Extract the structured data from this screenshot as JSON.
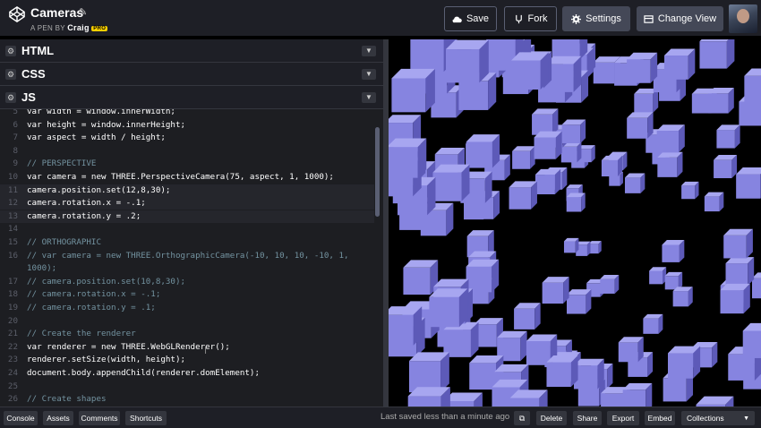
{
  "header": {
    "title": "Cameras",
    "subtitle_prefix": "A PEN BY",
    "author": "Craig",
    "badge": "PRO",
    "buttons": {
      "save": "Save",
      "fork": "Fork",
      "settings": "Settings",
      "change_view": "Change View"
    }
  },
  "panels": {
    "html": "HTML",
    "css": "CSS",
    "js": "JS"
  },
  "code_lines": [
    {
      "n": "5",
      "t": "var width = window.innerWidth;",
      "comment": false,
      "hl": false
    },
    {
      "n": "6",
      "t": "var height = window.innerHeight;",
      "comment": false,
      "hl": false
    },
    {
      "n": "7",
      "t": "var aspect = width / height;",
      "comment": false,
      "hl": false
    },
    {
      "n": "8",
      "t": "",
      "comment": false,
      "hl": false
    },
    {
      "n": "9",
      "t": "// PERSPECTIVE",
      "comment": true,
      "hl": false
    },
    {
      "n": "10",
      "t": "var camera = new THREE.PerspectiveCamera(75, aspect, 1, 1000);",
      "comment": false,
      "hl": false
    },
    {
      "n": "11",
      "t": "camera.position.set(12,8,30);",
      "comment": false,
      "hl": true
    },
    {
      "n": "12",
      "t": "camera.rotation.x = -.1;",
      "comment": false,
      "hl": true
    },
    {
      "n": "13",
      "t": "camera.rotation.y = .2;",
      "comment": false,
      "hl": true
    },
    {
      "n": "14",
      "t": "",
      "comment": false,
      "hl": false
    },
    {
      "n": "15",
      "t": "// ORTHOGRAPHIC",
      "comment": true,
      "hl": false
    },
    {
      "n": "16",
      "t": "// var camera = new THREE.OrthographicCamera(-10, 10, 10, -10, 1,",
      "comment": true,
      "hl": false
    },
    {
      "n": "",
      "t": "1000);",
      "comment": true,
      "hl": false
    },
    {
      "n": "17",
      "t": "// camera.position.set(10,8,30);",
      "comment": true,
      "hl": false
    },
    {
      "n": "18",
      "t": "// camera.rotation.x = -.1;",
      "comment": true,
      "hl": false
    },
    {
      "n": "19",
      "t": "// camera.rotation.y = .1;",
      "comment": true,
      "hl": false
    },
    {
      "n": "20",
      "t": "",
      "comment": false,
      "hl": false
    },
    {
      "n": "21",
      "t": "// Create the renderer",
      "comment": true,
      "hl": false
    },
    {
      "n": "22",
      "t": "var renderer = new THREE.WebGLRenderer();",
      "comment": false,
      "hl": false
    },
    {
      "n": "23",
      "t": "renderer.setSize(width, height);",
      "comment": false,
      "hl": false
    },
    {
      "n": "24",
      "t": "document.body.appendChild(renderer.domElement);",
      "comment": false,
      "hl": false
    },
    {
      "n": "25",
      "t": "",
      "comment": false,
      "hl": false
    },
    {
      "n": "26",
      "t": "// Create shapes",
      "comment": true,
      "hl": false
    }
  ],
  "footer": {
    "console": "Console",
    "assets": "Assets",
    "comments": "Comments",
    "shortcuts": "Shortcuts",
    "saved_status": "Last saved less than a minute ago",
    "delete": "Delete",
    "share": "Share",
    "export": "Export",
    "embed": "Embed",
    "collections": "Collections"
  },
  "colors": {
    "cube_front": "#8684e0",
    "cube_top": "#a7a6f0",
    "cube_side": "#5d5ab8"
  }
}
